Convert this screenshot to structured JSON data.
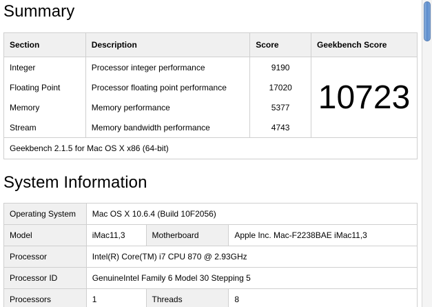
{
  "summary": {
    "heading": "Summary",
    "headers": {
      "section": "Section",
      "description": "Description",
      "score": "Score",
      "geekbench_score": "Geekbench Score"
    },
    "rows": [
      {
        "section": "Integer",
        "description": "Processor integer performance",
        "score": "9190"
      },
      {
        "section": "Floating Point",
        "description": "Processor floating point performance",
        "score": "17020"
      },
      {
        "section": "Memory",
        "description": "Memory performance",
        "score": "5377"
      },
      {
        "section": "Stream",
        "description": "Memory bandwidth performance",
        "score": "4743"
      }
    ],
    "geekbench_score": "10723",
    "footer": "Geekbench 2.1.5 for Mac OS X x86 (64-bit)"
  },
  "system_info": {
    "heading": "System Information",
    "os_label": "Operating System",
    "os_value": "Mac OS X 10.6.4 (Build 10F2056)",
    "model_label": "Model",
    "model_value": "iMac11,3",
    "motherboard_label": "Motherboard",
    "motherboard_value": "Apple Inc. Mac-F2238BAE iMac11,3",
    "processor_label": "Processor",
    "processor_value": "Intel(R) Core(TM) i7 CPU 870 @ 2.93GHz",
    "processor_id_label": "Processor ID",
    "processor_id_value": "GenuineIntel Family 6 Model 30 Stepping 5",
    "processors_label": "Processors",
    "processors_value": "1",
    "threads_label": "Threads",
    "threads_value": "8"
  },
  "colors": {
    "header_bg": "#f0f0f0",
    "border": "#cfcfcf",
    "scroll_thumb": "#5b8ccd"
  }
}
